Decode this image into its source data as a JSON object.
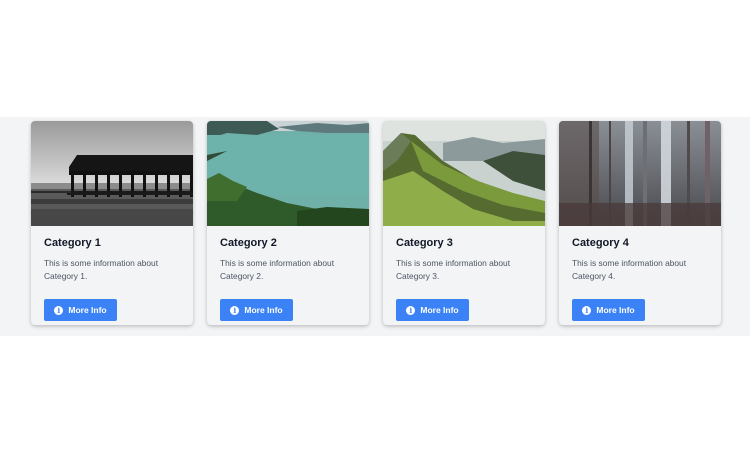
{
  "cards": [
    {
      "title": "Category 1",
      "description": "This is some information about Category 1.",
      "button_label": "More Info",
      "button_icon": "info-circle-icon",
      "image": "pier-pavilion-bw"
    },
    {
      "title": "Category 2",
      "description": "This is some information about Category 2.",
      "button_label": "More Info",
      "button_icon": "info-circle-icon",
      "image": "mountain-lake"
    },
    {
      "title": "Category 3",
      "description": "This is some information about Category 3.",
      "button_label": "More Info",
      "button_icon": "info-circle-icon",
      "image": "green-mountain-valley"
    },
    {
      "title": "Category 4",
      "description": "This is some information about Category 4.",
      "button_label": "More Info",
      "button_icon": "info-circle-icon",
      "image": "misty-forest"
    }
  ],
  "colors": {
    "button": "#3b82f6",
    "card_bg": "#f3f4f6",
    "title": "#111827",
    "text": "#4b5563"
  }
}
